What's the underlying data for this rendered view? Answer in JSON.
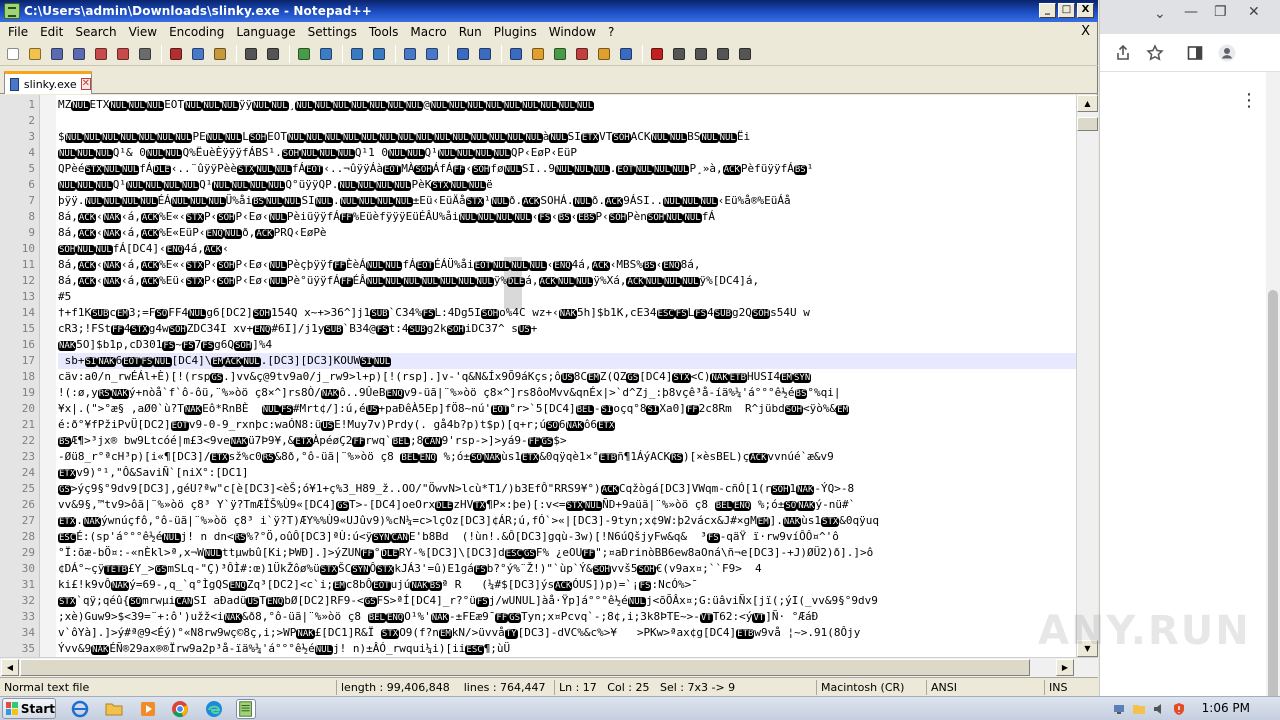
{
  "window": {
    "title": "C:\\Users\\admin\\Downloads\\slinky.exe - Notepad++",
    "minimize": "_",
    "maximize": "□",
    "close": "X"
  },
  "menu": [
    "File",
    "Edit",
    "Search",
    "View",
    "Encoding",
    "Language",
    "Settings",
    "Tools",
    "Macro",
    "Run",
    "Plugins",
    "Window",
    "?"
  ],
  "menu_close": "X",
  "toolbar": [
    {
      "name": "new-file-icon",
      "color": "#ffffff"
    },
    {
      "name": "open-file-icon",
      "color": "#f2c14e"
    },
    {
      "name": "save-icon",
      "color": "#5b6bb2"
    },
    {
      "name": "save-all-icon",
      "color": "#5b6bb2"
    },
    {
      "name": "close-file-icon",
      "color": "#c94a4a"
    },
    {
      "name": "close-all-icon",
      "color": "#c94a4a"
    },
    {
      "name": "print-icon",
      "color": "#6b6b6b"
    },
    {
      "sep": true
    },
    {
      "name": "cut-icon",
      "color": "#b03030"
    },
    {
      "name": "copy-icon",
      "color": "#4a78c8"
    },
    {
      "name": "paste-icon",
      "color": "#c49a3c"
    },
    {
      "sep": true
    },
    {
      "name": "undo-icon",
      "color": "#555555"
    },
    {
      "name": "redo-icon",
      "color": "#555555"
    },
    {
      "sep": true
    },
    {
      "name": "find-icon",
      "color": "#4a9a4a"
    },
    {
      "name": "replace-icon",
      "color": "#3c7cc4"
    },
    {
      "sep": true
    },
    {
      "name": "zoom-in-icon",
      "color": "#3a7ac0"
    },
    {
      "name": "zoom-out-icon",
      "color": "#3a7ac0"
    },
    {
      "sep": true
    },
    {
      "name": "sync-v-icon",
      "color": "#4a78c8"
    },
    {
      "name": "sync-h-icon",
      "color": "#4a78c8"
    },
    {
      "sep": true
    },
    {
      "name": "word-wrap-icon",
      "color": "#3a6bc0"
    },
    {
      "name": "all-chars-icon",
      "color": "#3a6bc0"
    },
    {
      "sep": true
    },
    {
      "name": "indent-guide-icon",
      "color": "#3a6bc0"
    },
    {
      "name": "udl-icon",
      "color": "#e0a030"
    },
    {
      "name": "doc-map-icon",
      "color": "#4a9a4a"
    },
    {
      "name": "function-list-icon",
      "color": "#c04040"
    },
    {
      "name": "folder-workspace-icon",
      "color": "#e0a030"
    },
    {
      "name": "monitoring-icon",
      "color": "#3a6bc0"
    },
    {
      "sep": true
    },
    {
      "name": "record-macro-icon",
      "color": "#c02020"
    },
    {
      "name": "stop-macro-icon",
      "color": "#555555"
    },
    {
      "name": "play-macro-icon",
      "color": "#555555"
    },
    {
      "name": "play-multiple-icon",
      "color": "#555555"
    },
    {
      "name": "save-macro-icon",
      "color": "#555555"
    }
  ],
  "tab": {
    "label": "slinky.exe",
    "close": "✕"
  },
  "lines": [
    {
      "n": "1",
      "t": "MZ[NUL]ETX[NUL][NUL][NUL]EOT[NUL][NUL][NUL]ÿÿ[NUL][NUL]¸[NUL][NUL][NUL][NUL][NUL][NUL][NUL]@[NUL][NUL][NUL][NUL][NUL][NUL][NUL][NUL][NUL]"
    },
    {
      "n": "2",
      "t": ""
    },
    {
      "n": "3",
      "t": "$[NUL][NUL][NUL][NUL][NUL][NUL][NUL]PE[NUL][NUL]L[SOH]EOT[NUL][NUL][NUL][NUL][NUL][NUL][NUL][NUL][NUL][NUL][NUL][NUL][NUL][NUL]à[NUL]SI[ETX]VT[SOH]ACK[NUL][NUL]BS[NUL][NUL]Ëi"
    },
    {
      "n": "4",
      "t": "[NUL][NUL][NUL]Q¹& 0[NUL][NUL]Q%ËuèÈÿÿÿfÁBS¹.[SOH][NUL][NUL][NUL]Q¹1 0[NUL][NUL]Q¹[NUL][NUL][NUL][NUL]QP‹EøP‹EüP"
    },
    {
      "n": "5",
      "t": "QPèé[STX][NUL][NUL]fÁ[DLE]‹..¨ûÿÿPèè[STX][NUL][NUL]fÁ[EOT]‹..¬ûÿÿÁà[EOT]MÀ[SOH]ÁfÁ[FF]‹[SOH]fø[NUL]SI..9[NUL][NUL][NUL].[EOT][NUL][NUL][NUL]P¸»à,[ACK]PèfüÿÿfÁ[BS]¹"
    },
    {
      "n": "6",
      "t": "[NUL][NUL][NUL]Q¹[NUL][NUL][NUL][NUL]Q¹[NUL][NUL][NUL][NUL]Q°üÿÿQP.[NUL][NUL][NUL][NUL]PèK[STX][NUL][NUL]ë"
    },
    {
      "n": "7",
      "t": "þÿÿ.[NUL][NUL][NUL][NUL]ÉÁ[NUL][NUL][NUL]Ü%åi[BS][NUL][NUL]SI[NUL].[NUL][NUL][NUL][NUL]±Eü‹EüÄå[STX]¹[NUL]ð.[ACK]SOHÁ.[NUL]ð.[ACK]9ÁSI..[NUL][NUL][NUL]‹Eü%å®%EüÁå"
    },
    {
      "n": "8",
      "t": "8á,[ACK]‹[NAK]‹á,[ACK]%E«‹[STX]P‹[SOH]P‹Eø‹[NUL]PèiüÿÿfÁ[FF]%EüèfÿÿÿEüÉÂU%åi[NUL][NUL][NUL][NUL]‹[FS]‹[BS]‹[EBS]P‹[SOH]Pèn[SOH][NUL][NUL]fÁ"
    },
    {
      "n": "9",
      "t": "8á,[ACK]‹[NAK]‹á,[ACK]%E«EüP‹[ENQ][NUL]ð,[ACK]PRQ‹EøPè"
    },
    {
      "n": "10",
      "t": "[SOH][NUL][NUL]fÁ[DC4]‹[ENQ]4á,[ACK]‹"
    },
    {
      "n": "11",
      "t": "8á,[ACK]‹[NAK]‹á,[ACK]%E«‹[STX]P‹[SOH]P‹Eø‹[NUL]Pèçþÿÿf[FF]ÈèÁ[NUL][NUL]fÁ[EOT]ÉÁÜ%åi[EOT][NUL][NUL][NUL]‹[ENQ]4á,[ACK]‹MBS%[BS]‹[ENQ]8á,"
    },
    {
      "n": "12",
      "t": "8á,[ACK]‹[NAK]‹á,[ACK]%Eü‹[STX]P‹[SOH]P‹Eø‹[NUL]Pè°üÿÿfÁ[FF]ÉÂ[NUL][NUL][NUL][NUL][NUL][NUL][NUL]ÿ%[DLE]á,[ACK][NUL][NUL]ÿ%Xá,[ACK][NUL][NUL][NUL]ÿ%[DC4]á,"
    },
    {
      "n": "13",
      "t": "#5"
    },
    {
      "n": "14",
      "t": "†+f1K[SUB]c[EM]3;=F[SO]FF4[NUL]g6[DC2][SOH]154Q x~+>36^]j1[SUB]`C34%[FS]L:4Dg5I[SOH]o%4C wz+‹[NAK]5h]$b1K,cE34[ESC][FS]L[FS]4[SUB]g2Q[SOH]s54U w"
    },
    {
      "n": "15",
      "t": "cR3;!FSt[FF]4[STX]g4w[SOH]ZDC34I xv+[ENQ]#6I]/j1y[SUB]`B34@[FS]t:4[SUB]g2k[SOH]iDC37^ s[US]+"
    },
    {
      "n": "16",
      "t": "[NAK]5O]$b1p,cD301[FS]~[FS]7[FS]g6Q[SOH]]%4"
    },
    {
      "n": "17",
      "t": " sb+[SI][NAK]6[EOT][FS][NUL][DC4]\\[EM][ACK][NUL].[DC3][DC3]KOUW[SI][NUL]"
    },
    {
      "n": "18",
      "t": "cäv:a0/n_rwÉÁl+È)[!(rsp[GS].]vv&ç@9tv9a0/j_rw9>l+p)[!(rsp].]v-'q&N&Íx9Õ9áKçs;ô[US]8C[EM]Z(QZ[GS][DC4][STX]<C)[NAK][ETB]HUSI4[EM][SYN]"
    },
    {
      "n": "19",
      "t": "!(:ø,y[RS][NAK]ý+nòå`f`ô-ôü,¨%»òö ç8×^]rs8Ò/[NAK]ô..9ÛeB[ENQ]v9-üã|¨%»òö ç8×^]rs8ôoMvv&qnÉx|>`d^Zj_:þ8vçê³å-íä%¼'á°°°ê½é[BS]°%qi|"
    },
    {
      "n": "20",
      "t": "¥x|.(\">°æ§ ,aØ0`ù?T[NAK]Eô*RnBÈ  [NUL][FS]#Mrt¢/]:ú,é[US]+paÐêÀ5Ep]fÖ8~nú'[EOT]°r>`5[DC4][BEL]-[SI]oçq°8[SI]Xa0][FF]2c8Rm  R^jübd[SOH]<ÿò%&[EM]"
    },
    {
      "n": "21",
      "t": "é:ð°¥fPžiPvÜ[DC2][EOT]v9-0-9_rxnþc:waÓN8:ü[US]E!Muy7v)Prdy(. gå4b?p)t$p)[q+r;ú[SO]6[NAK]ô6[ETX]"
    },
    {
      "n": "22",
      "t": "[BS]Æ¶>³jx® bw9Ltcóé|m£3<9ve[NAK]ü7Þ9¥,&[ETX]ÀpéøÇ2[FF]rwq`[BEL];8[CAN]9'rsp->]>yá9-[FF][GS]$>"
    },
    {
      "n": "23",
      "t": "-Øü8_r°ªcH³p)[i«¶[DC3]/[ETX]sž%c0[RS]&8ð,°ô-üã|¨%»òö ç8 [BEL][ENQ] %;ó±[SO][NAK]ùs1[ETX]&0qÿqè1×°[ETB]ñ¶1ÁýACK[RS])[×èsBEL)ç[ACK]vvnúé`æ&v9"
    },
    {
      "n": "24",
      "t": "[ETX]v9)°¹,\"Ô&SaviÑ`[niX°:[DC1]"
    },
    {
      "n": "25",
      "t": "[GS]>ýç9§°9dv9[DC3],géU?ªw\"c[è[DC3]<èŠ;ó¥1+ç%3_H89_ž..OO/\"ÖwvN>lcù*T1/)b3EfÔ\"RRS9¥°)[ACK]Cqžògá[DC3]VWqm-cñÓ[1(r[SOH]1[NAK]-ÝQ>-8"
    },
    {
      "n": "26",
      "t": "vv&9§,™tv9>ôã|¨%»òö ç8³ Y`ÿ?TmÆÏŠ%Ù9«[DC4][GS]T>-[DC4]oeOrx[DLE]zHV[TX]¶P×:þe)[:v<=[STX][NUL]ÑD+9aüã|¨%»òö ç8 [BEL][ENQ] %;ó±[SO][NAK]ý-nü#`"
    },
    {
      "n": "27",
      "t": "[ETX].[NAK]ýwnúçfô,°ô-üã|¨%»òö ç8³ i`ÿ?T)ÆY%%Ù9«UJûv9)%cN¼=c>lçOz[DC3]¢ÁR;ú,fÓ`>«|[DC3]-9tyn;x¢9W:þ2vácx&J#×gM[EM]].[NAK]ùs1[STX]&0qÿuq"
    },
    {
      "n": "28",
      "t": "[ESC]É:(sp'á°°°ê½é[NUL]j! n dn<[RS]%?°Ö,oûÔ[DC3]ªÙ:ú<ÿ[SYN][CAN]E'b8Bd  (!ùn!.&Ô[DC3]gqù-3w)[!N6úQšjyFw&q&  ³[FS]-qäŸ ï·rw9víÔÔ¤^'ô"
    },
    {
      "n": "29",
      "t": "°Ï:õæ-bÖ¤:-«nÈkl>ª,x¬W[NUL]ttµwbû[Ki;ÞWÐ].]>ýZUN[FF]°[DLE]RY-%[DC3]\\[DC3]d[ESC][GS]F% ¿eOU[FF]\";¤aÐrinòBB6ew8aOná\\ñ¬e[DC3]-+J)ØÜ2)ð].]>ô"
    },
    {
      "n": "30",
      "t": "¢DÁ°~çÿ[TETB]£Y_>[GS]mSLq-\"Ç)³ÔÌ#:œ)1ÜkŽôø%ü[STX]ŠC[SYN]Ô[STX]kJÁ3'=û)E1gá[FS]b?°ý%¨Ž!)\"`ùp`Ý&[SOH]vvš5[SOH]€(v9ax¤;``F9>  4"
    },
    {
      "n": "31",
      "t": "ki£!k9vÔ[NAK]ý=69-,q_`q°ÌgQS[ENQ]Zq³[DC2]<c`i;[EM]c8bÔ[EOT]ujú[NAK][BS]ª R   (¼#$[DC3]ýs[ACK]ÓUS])p)=`¡[FS]:NcÓ%>¯"
    },
    {
      "n": "32",
      "t": "[STX]`qÿ;qéû{[SO]mrwµi[CAN]SI aÐadü[US]T[ENQ]bØ[DC2]RF9-<[GS]FS>ªÍ[DC4]_r?°ü[FS]j/wUNUL]àå·Ÿp]á°°°ê½é[NUL]j<õÕÂx¤;G:üâviÑx[jï(;ýI(_vv&9§°9dv9"
    },
    {
      "n": "33",
      "t": ";xè)Guw9>$<39=¨+:ô')užž<i[NAK]&ð8,°ô-üã|¨%»òö ç8 [BEL][ENQ]O¹%'[NAK]-±FEæ9¯[FF][GS]Tyn;x¤Pcvq`-;8¢,i;3k8ÞTE~>-[VT]T62:<ý[VT]]Ñ· °ÆáÐ"
    },
    {
      "n": "34",
      "t": "v`ôYà].]>ý#ª@9<Éý)°«N8rw9wç©8ç,i;>WP[NAK]£[DC1]R&Ï [STX]O9(f?n[EM]kN/>üvvå[TY][DC3]-dVC%&c%>¥   >PKw>ªax¢g[DC4][ETB]w9vå ¦~>.91(8Ôjy"
    },
    {
      "n": "35",
      "t": "Ývv&9[NAK]ÉÑ®29ax®®Ïrw9a2p³å-ïä%¼'á°°°ê½é[NUL]j! n)±ÂÓ_rwqui¼i)[ii[ESC]¶;ùÜ"
    }
  ],
  "current_line": "17",
  "status": {
    "type": "Normal text file",
    "length": "length : 99,406,848",
    "lines": "lines : 764,447",
    "ln": "Ln : 17",
    "col": "Col : 25",
    "sel": "Sel : 7x3 -> 9",
    "eol": "Macintosh (CR)",
    "encoding": "ANSI",
    "mode": "INS"
  },
  "taskbar": {
    "start": "Start",
    "clock": "1:06 PM",
    "watermark": "ANY.RUN"
  },
  "browser": {
    "chevron": "⌄",
    "minimize": "—",
    "restore": "❐",
    "close": "✕",
    "menu": "⋮"
  }
}
